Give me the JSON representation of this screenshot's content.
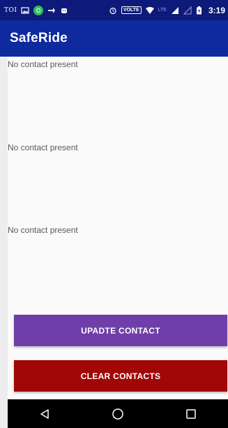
{
  "status_bar": {
    "carrier_text": "TOI",
    "volte": "VOLTE",
    "lte": "LTE",
    "time": "3:19",
    "icons": [
      "image-icon",
      "app-circle-icon",
      "navigation-arrow-icon",
      "android-icon",
      "alarm-icon",
      "wifi-icon",
      "signal-icon",
      "signal-empty-icon",
      "battery-icon"
    ]
  },
  "app_bar": {
    "title": "SafeRide"
  },
  "contacts": [
    {
      "text": "No contact present"
    },
    {
      "text": "No contact present"
    },
    {
      "text": "No contact present"
    }
  ],
  "buttons": {
    "update_label": "UPADTE CONTACT",
    "clear_label": "CLEAR CONTACTS"
  },
  "colors": {
    "status_bar": "#0d1a7a",
    "app_bar": "#0f2a9e",
    "update_button": "#6f3ea8",
    "clear_button": "#a10707"
  },
  "nav_bar": {
    "icons": [
      "back-icon",
      "home-icon",
      "recents-icon"
    ]
  }
}
